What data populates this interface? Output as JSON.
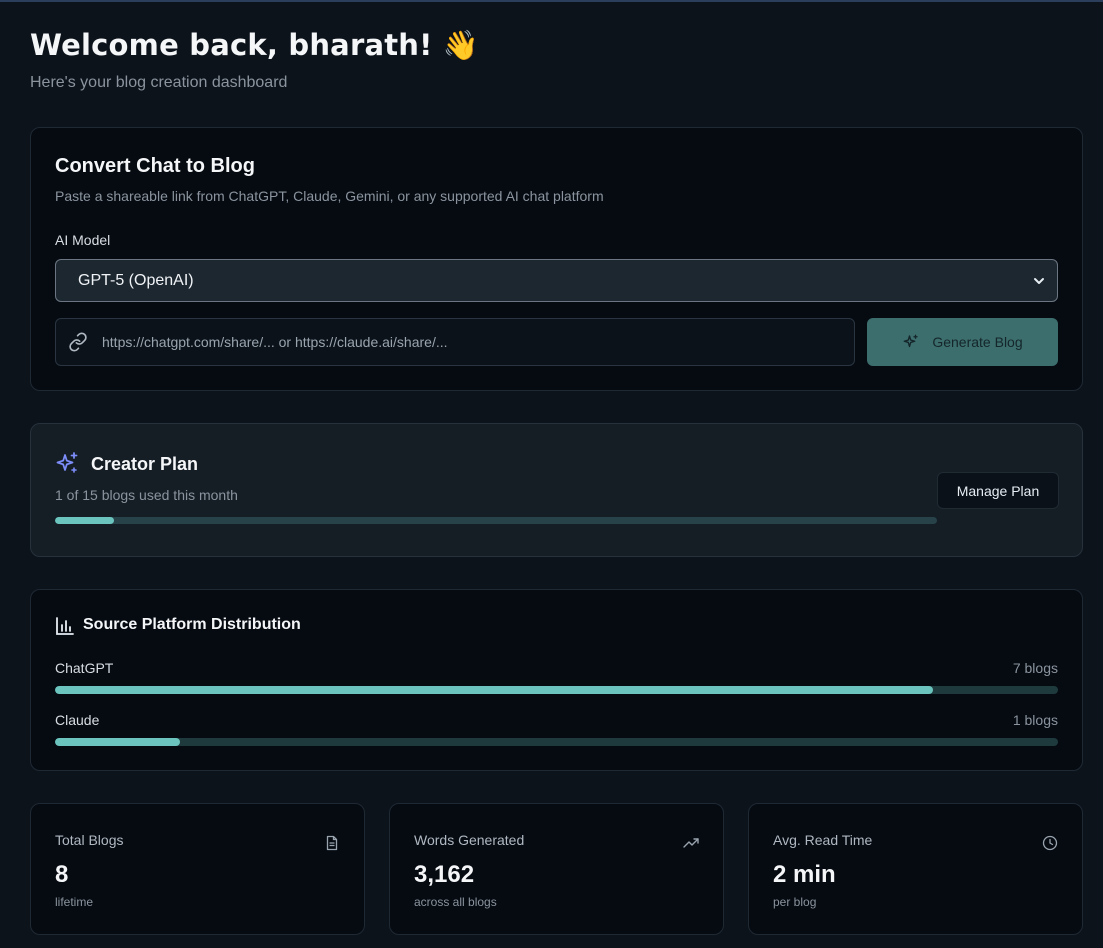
{
  "header": {
    "title": "Welcome back, bharath! 👋",
    "subtitle": "Here's your blog creation dashboard"
  },
  "convert": {
    "title": "Convert Chat to Blog",
    "description": "Paste a shareable link from ChatGPT, Claude, Gemini, or any supported AI chat platform",
    "model_label": "AI Model",
    "model_selected": "GPT-5 (OpenAI)",
    "url_value": "",
    "url_placeholder": "https://chatgpt.com/share/... or https://claude.ai/share/...",
    "generate_label": "Generate Blog",
    "icons": {
      "link": "link-icon",
      "generate": "sparkles-icon",
      "select": "chevron-down-icon"
    }
  },
  "plan": {
    "name": "Creator Plan",
    "usage_text": "1 of 15 blogs used this month",
    "used": 1,
    "limit": 15,
    "manage_label": "Manage Plan",
    "icon": "sparkles-icon"
  },
  "distribution": {
    "title": "Source Platform Distribution",
    "icon": "bar-chart-icon",
    "platforms": [
      {
        "name": "ChatGPT",
        "count_text": "7 blogs",
        "fraction": 0.875
      },
      {
        "name": "Claude",
        "count_text": "1 blogs",
        "fraction": 0.125
      }
    ]
  },
  "stats": [
    {
      "label": "Total Blogs",
      "value": "8",
      "sub": "lifetime",
      "icon": "document-icon"
    },
    {
      "label": "Words Generated",
      "value": "3,162",
      "sub": "across all blogs",
      "icon": "trending-up-icon"
    },
    {
      "label": "Avg. Read Time",
      "value": "2 min",
      "sub": "per blog",
      "icon": "clock-icon"
    }
  ],
  "colors": {
    "background": "#0d131b",
    "card": "#060b12",
    "accent": "#6bc4bd",
    "generate_button": "#3d6e6e",
    "plan_icon": "#7c8cf8"
  }
}
